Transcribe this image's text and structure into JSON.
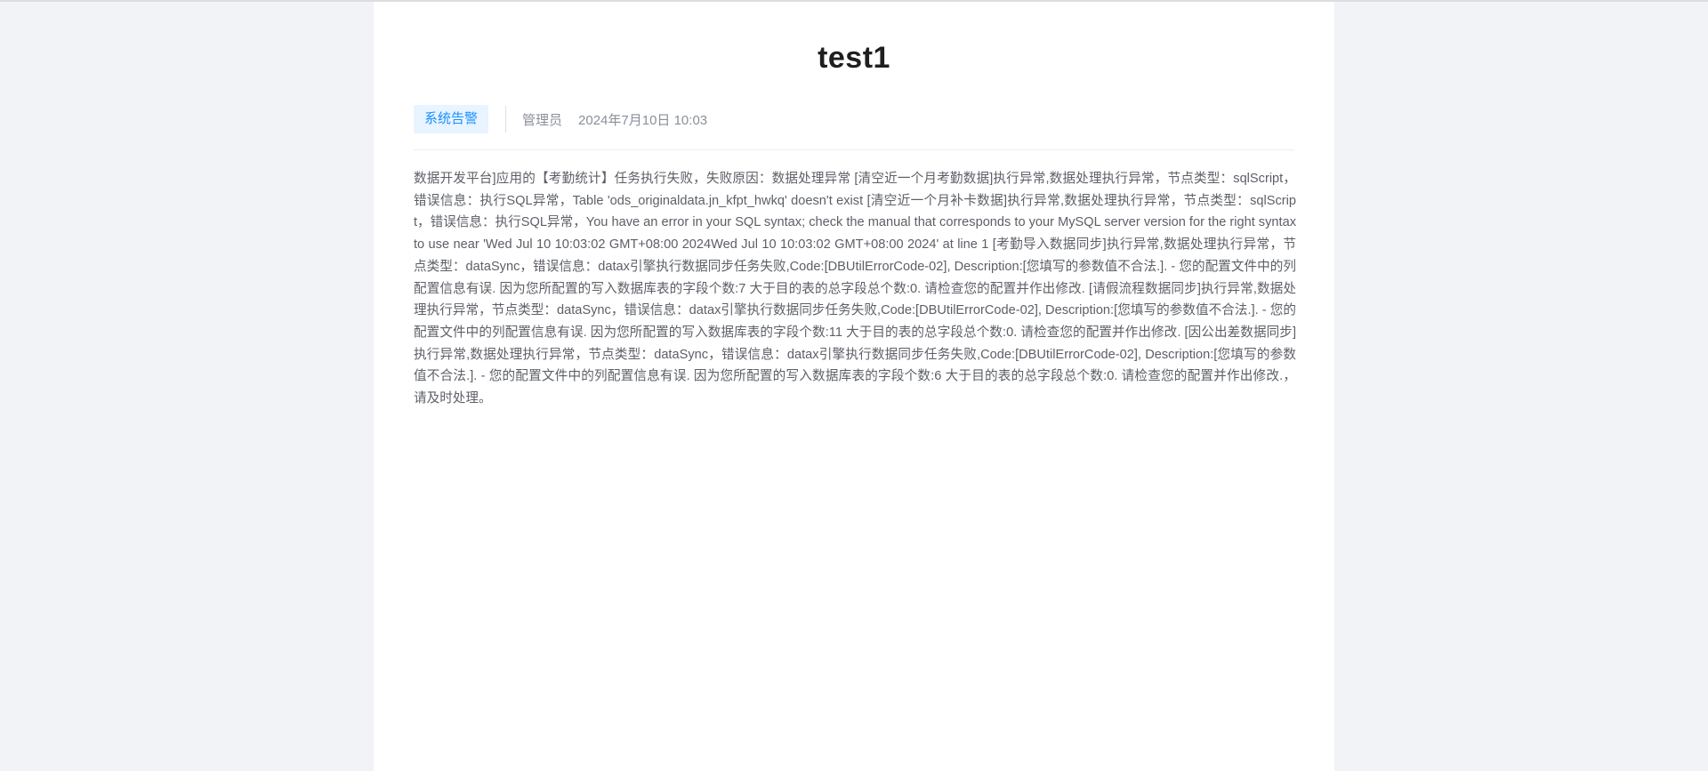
{
  "article": {
    "title": "test1",
    "category_tag": "系统告警",
    "author": "管理员",
    "datetime": "2024年7月10日 10:03",
    "body": "数据开发平台]应用的【考勤统计】任务执行失败，失败原因：数据处理异常 [清空近一个月考勤数据]执行异常,数据处理执行异常，节点类型：sqlScript，错误信息：执行SQL异常，Table 'ods_originaldata.jn_kfpt_hwkq' doesn't exist [清空近一个月补卡数据]执行异常,数据处理执行异常，节点类型：sqlScript，错误信息：执行SQL异常，You have an error in your SQL syntax; check the manual that corresponds to your MySQL server version for the right syntax to use near 'Wed Jul 10 10:03:02 GMT+08:00 2024Wed Jul 10 10:03:02 GMT+08:00 2024' at line 1 [考勤导入数据同步]执行异常,数据处理执行异常，节点类型：dataSync，错误信息：datax引擎执行数据同步任务失败,Code:[DBUtilErrorCode-02], Description:[您填写的参数值不合法.]. - 您的配置文件中的列配置信息有误. 因为您所配置的写入数据库表的字段个数:7 大于目的表的总字段总个数:0. 请检查您的配置并作出修改. [请假流程数据同步]执行异常,数据处理执行异常，节点类型：dataSync，错误信息：datax引擎执行数据同步任务失败,Code:[DBUtilErrorCode-02], Description:[您填写的参数值不合法.]. - 您的配置文件中的列配置信息有误. 因为您所配置的写入数据库表的字段个数:11 大于目的表的总字段总个数:0. 请检查您的配置并作出修改. [因公出差数据同步]执行异常,数据处理执行异常，节点类型：dataSync，错误信息：datax引擎执行数据同步任务失败,Code:[DBUtilErrorCode-02], Description:[您填写的参数值不合法.]. - 您的配置文件中的列配置信息有误. 因为您所配置的写入数据库表的字段个数:6 大于目的表的总字段总个数:0. 请检查您的配置并作出修改.，请及时处理。"
  },
  "colors": {
    "background": "#f2f3f6",
    "card": "#ffffff",
    "tag_bg": "#e8f4ff",
    "tag_text": "#1890ff",
    "title_text": "#1f1f1f",
    "meta_text": "#8a8f99",
    "body_text": "#5c5f66"
  }
}
